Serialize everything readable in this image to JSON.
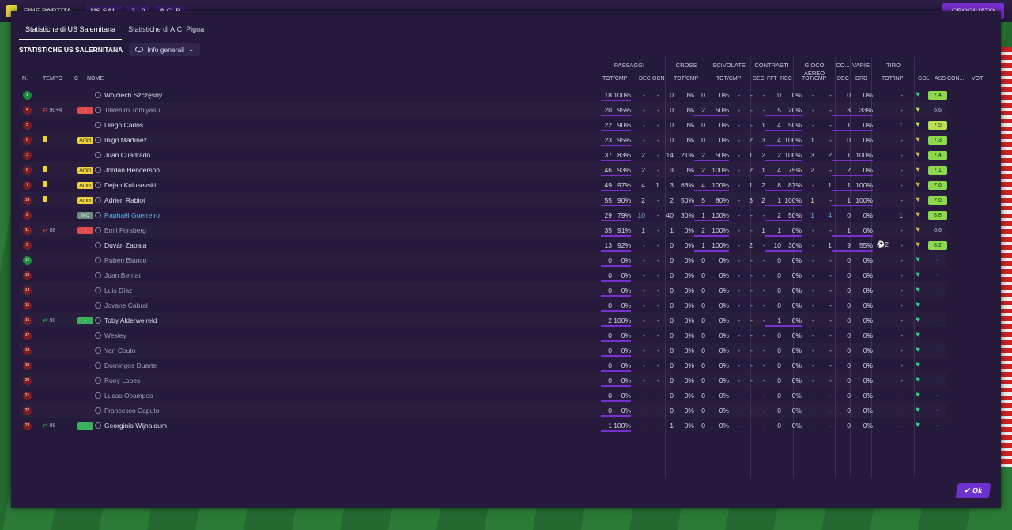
{
  "topbar": {
    "title": "FINE PARTITA",
    "home": "US SAL",
    "score": "2 - 0",
    "away": "A.C. P",
    "right_button": "CROGIUATO"
  },
  "tabs": [
    {
      "label": "Statistiche di US Salernitana",
      "active": true
    },
    {
      "label": "Statistiche di A.C. Pigna",
      "active": false
    }
  ],
  "subheader": {
    "title": "STATISTICHE US SALERNITANA",
    "dropdown": "Info generali"
  },
  "groups": [
    "PASSAGGI",
    "CROSS",
    "SCIVOLATE",
    "CONTRASTI",
    "GIOCO AEREO",
    "CO...",
    "VARIE",
    "TIRO"
  ],
  "columns": {
    "n": "N.",
    "tempo": "TEMPO",
    "c": "C",
    "nome": "NOME",
    "pass_tot": "TOT/CMP",
    "pass_dec": "DEC",
    "pass_ocn": "OCN",
    "cross_tot": "TOT/CMP",
    "sciv_tot": "TOT/CMP",
    "con_dec": "DEC",
    "con_fft": "FFT",
    "con_rec": "REC",
    "aer_tot": "TOT/CMP",
    "co_dec": "DEC",
    "var_drb": "DRB",
    "tiro_tot": "TOT/INP",
    "gol": "GOL",
    "ass": "ASS",
    "con": "CON...",
    "vot": "VOT"
  },
  "players": [
    {
      "num": "1",
      "badge": "g",
      "tempo": "",
      "card": "",
      "pos": "",
      "name": "Wojciech Szczęsny",
      "p": [
        "18",
        "100%",
        "-",
        "-"
      ],
      "cr": [
        "0",
        "0%"
      ],
      "sc": [
        "0",
        "0%"
      ],
      "ct": [
        "-",
        "-",
        "-"
      ],
      "ae": [
        "0",
        "0%"
      ],
      "cod": "-",
      "drb": "-",
      "ti": [
        "0",
        "0%"
      ],
      "gol": "",
      "ass": "-",
      "heart": "g",
      "vot": "7.4",
      "vc": "g"
    },
    {
      "num": "4",
      "badge": "r",
      "tempo": "90+4",
      "sub": "out",
      "card": "",
      "pos": "",
      "name": "Takehiro Tomiyasu",
      "dim": true,
      "p": [
        "20",
        "95%",
        "-",
        "-"
      ],
      "cr": [
        "0",
        "0%"
      ],
      "sc": [
        "2",
        "50%"
      ],
      "ct": [
        "-",
        "-",
        "-"
      ],
      "ae": [
        "5",
        "20%"
      ],
      "cod": "-",
      "drb": "-",
      "ti": [
        "3",
        "33%"
      ],
      "gol": "",
      "ass": "-",
      "heart": "y",
      "vot": "6.6",
      "vc": "n"
    },
    {
      "num": "5",
      "badge": "r",
      "tempo": "",
      "card": "",
      "pos": "",
      "name": "Diego Carlos",
      "p": [
        "22",
        "90%",
        "-",
        "-"
      ],
      "cr": [
        "0",
        "0%"
      ],
      "sc": [
        "0",
        "0%"
      ],
      "ct": [
        "-",
        "-",
        "1"
      ],
      "ae": [
        "4",
        "50%"
      ],
      "cod": "-",
      "drb": "-",
      "ti": [
        "1",
        "0%"
      ],
      "gol": "",
      "ass": "1",
      "heart": "y",
      "vot": "7.5",
      "vc": "y"
    },
    {
      "num": "6",
      "badge": "r",
      "tempo": "",
      "card": "y",
      "pos": "Amm",
      "name": "Iñigo Martínez",
      "p": [
        "23",
        "95%",
        "-",
        "-"
      ],
      "cr": [
        "0",
        "0%"
      ],
      "sc": [
        "0",
        "0%"
      ],
      "ct": [
        "-",
        "2",
        "3"
      ],
      "ae": [
        "4",
        "100%"
      ],
      "cod": "1",
      "drb": "-",
      "ti": [
        "0",
        "0%"
      ],
      "gol": "",
      "ass": "-",
      "heart": "o",
      "vot": "7.3",
      "vc": "g"
    },
    {
      "num": "3",
      "badge": "r",
      "tempo": "",
      "card": "",
      "pos": "",
      "name": "Juan Cuadrado",
      "p": [
        "37",
        "83%",
        "2",
        "-"
      ],
      "cr": [
        "14",
        "21%"
      ],
      "sc": [
        "2",
        "50%"
      ],
      "ct": [
        "-",
        "1",
        "2"
      ],
      "ae": [
        "2",
        "100%"
      ],
      "cod": "3",
      "drb": "2",
      "ti": [
        "1",
        "100%"
      ],
      "gol": "",
      "ass": "-",
      "heart": "o",
      "vot": "7.4",
      "vc": "g"
    },
    {
      "num": "8",
      "badge": "r",
      "tempo": "",
      "card": "y",
      "pos": "Amm",
      "name": "Jordan Henderson",
      "p": [
        "46",
        "93%",
        "2",
        "-"
      ],
      "cr": [
        "3",
        "0%"
      ],
      "sc": [
        "2",
        "100%"
      ],
      "ct": [
        "-",
        "2",
        "1"
      ],
      "ae": [
        "4",
        "75%"
      ],
      "cod": "2",
      "drb": "-",
      "ti": [
        "2",
        "0%"
      ],
      "gol": "",
      "ass": "-",
      "heart": "o",
      "vot": "7.1",
      "vc": "g"
    },
    {
      "num": "7",
      "badge": "r",
      "tempo": "",
      "card": "y",
      "pos": "Amm",
      "name": "Dejan Kulusevski",
      "p": [
        "49",
        "97%",
        "4",
        "1"
      ],
      "cr": [
        "3",
        "66%"
      ],
      "sc": [
        "4",
        "100%"
      ],
      "ct": [
        "-",
        "1",
        "2"
      ],
      "ae": [
        "8",
        "87%"
      ],
      "cod": "-",
      "drb": "1",
      "ti": [
        "1",
        "100%"
      ],
      "gol": "",
      "ass": "-",
      "heart": "o",
      "vot": "7.6",
      "vc": "g"
    },
    {
      "num": "18",
      "badge": "r",
      "tempo": "",
      "card": "y",
      "pos": "Amm",
      "name": "Adrien Rabiot",
      "p": [
        "55",
        "90%",
        "2",
        "-"
      ],
      "cr": [
        "2",
        "50%"
      ],
      "sc": [
        "5",
        "80%"
      ],
      "ct": [
        "-",
        "3",
        "2"
      ],
      "ae": [
        "1",
        "100%"
      ],
      "cod": "1",
      "drb": "-",
      "ti": [
        "1",
        "100%"
      ],
      "gol": "",
      "ass": "-",
      "heart": "o",
      "vot": "7.0",
      "vc": "g"
    },
    {
      "num": "2",
      "badge": "r",
      "tempo": "",
      "card": "",
      "pos": "MC",
      "name": "Raphaël Guerreiro",
      "hl": true,
      "p": [
        "29",
        "79%",
        "10",
        "-"
      ],
      "cr": [
        "40",
        "30%"
      ],
      "sc": [
        "1",
        "100%"
      ],
      "ct": [
        "-",
        "-",
        "-"
      ],
      "ae": [
        "2",
        "50%"
      ],
      "cod": "1",
      "drb": "4",
      "ti": [
        "0",
        "0%"
      ],
      "gol": "",
      "ass": "1",
      "heart": "o",
      "vot": "8.8",
      "vc": "g"
    },
    {
      "num": "11",
      "badge": "r",
      "tempo": "88",
      "sub": "out",
      "card": "",
      "pos": "",
      "name": "Emil Forsberg",
      "dim": true,
      "p": [
        "35",
        "91%",
        "1",
        "-"
      ],
      "cr": [
        "1",
        "0%"
      ],
      "sc": [
        "2",
        "100%"
      ],
      "ct": [
        "-",
        "-",
        "1"
      ],
      "ae": [
        "1",
        "0%"
      ],
      "cod": "-",
      "drb": "-",
      "ti": [
        "1",
        "0%"
      ],
      "gol": "",
      "ass": "-",
      "heart": "o",
      "vot": "6.6",
      "vc": "n"
    },
    {
      "num": "9",
      "badge": "r",
      "tempo": "",
      "card": "",
      "pos": "",
      "name": "Duván Zapata",
      "p": [
        "13",
        "92%",
        "-",
        "-"
      ],
      "cr": [
        "0",
        "0%"
      ],
      "sc": [
        "1",
        "100%"
      ],
      "ct": [
        "-",
        "2",
        "-"
      ],
      "ae": [
        "10",
        "30%"
      ],
      "cod": "-",
      "drb": "1",
      "ti": [
        "9",
        "55%"
      ],
      "gol": "⚽2",
      "ass": "-",
      "heart": "o",
      "vot": "8.2",
      "vc": "g"
    },
    {
      "num": "12",
      "badge": "g",
      "tempo": "",
      "card": "",
      "pos": "",
      "name": "Rubén Blanco",
      "dim": true,
      "p": [
        "0",
        "0%",
        "-",
        "-"
      ],
      "cr": [
        "0",
        "0%"
      ],
      "sc": [
        "0",
        "0%"
      ],
      "ct": [
        "-",
        "-",
        "-"
      ],
      "ae": [
        "0",
        "0%"
      ],
      "cod": "-",
      "drb": "-",
      "ti": [
        "0",
        "0%"
      ],
      "gol": "",
      "ass": "-",
      "heart": "g",
      "vot": "-",
      "vc": "n"
    },
    {
      "num": "13",
      "badge": "r",
      "tempo": "",
      "card": "",
      "pos": "",
      "name": "Juan Bernat",
      "dim": true,
      "p": [
        "0",
        "0%",
        "-",
        "-"
      ],
      "cr": [
        "0",
        "0%"
      ],
      "sc": [
        "0",
        "0%"
      ],
      "ct": [
        "-",
        "-",
        "-"
      ],
      "ae": [
        "0",
        "0%"
      ],
      "cod": "-",
      "drb": "-",
      "ti": [
        "0",
        "0%"
      ],
      "gol": "",
      "ass": "-",
      "heart": "g",
      "vot": "-",
      "vc": "n"
    },
    {
      "num": "14",
      "badge": "r",
      "tempo": "",
      "card": "",
      "pos": "",
      "name": "Luis Díaz",
      "dim": true,
      "p": [
        "0",
        "0%",
        "-",
        "-"
      ],
      "cr": [
        "0",
        "0%"
      ],
      "sc": [
        "0",
        "0%"
      ],
      "ct": [
        "-",
        "-",
        "-"
      ],
      "ae": [
        "0",
        "0%"
      ],
      "cod": "-",
      "drb": "-",
      "ti": [
        "0",
        "0%"
      ],
      "gol": "",
      "ass": "-",
      "heart": "g",
      "vot": "-",
      "vc": "n"
    },
    {
      "num": "15",
      "badge": "r",
      "tempo": "",
      "card": "",
      "pos": "",
      "name": "Jovane Cabral",
      "dim": true,
      "p": [
        "0",
        "0%",
        "-",
        "-"
      ],
      "cr": [
        "0",
        "0%"
      ],
      "sc": [
        "0",
        "0%"
      ],
      "ct": [
        "-",
        "-",
        "-"
      ],
      "ae": [
        "0",
        "0%"
      ],
      "cod": "-",
      "drb": "-",
      "ti": [
        "0",
        "0%"
      ],
      "gol": "",
      "ass": "-",
      "heart": "g",
      "vot": "-",
      "vc": "n"
    },
    {
      "num": "16",
      "badge": "r",
      "tempo": "90",
      "sub": "in",
      "card": "",
      "pos": "",
      "name": "Toby Alderweireld",
      "p": [
        "2",
        "100%",
        "-",
        "-"
      ],
      "cr": [
        "0",
        "0%"
      ],
      "sc": [
        "0",
        "0%"
      ],
      "ct": [
        "-",
        "-",
        "-"
      ],
      "ae": [
        "1",
        "0%"
      ],
      "cod": "-",
      "drb": "-",
      "ti": [
        "0",
        "0%"
      ],
      "gol": "",
      "ass": "-",
      "heart": "g",
      "vot": "-",
      "vc": "n"
    },
    {
      "num": "17",
      "badge": "r",
      "tempo": "",
      "card": "",
      "pos": "",
      "name": "Wesley",
      "dim": true,
      "p": [
        "0",
        "0%",
        "-",
        "-"
      ],
      "cr": [
        "0",
        "0%"
      ],
      "sc": [
        "0",
        "0%"
      ],
      "ct": [
        "-",
        "-",
        "-"
      ],
      "ae": [
        "0",
        "0%"
      ],
      "cod": "-",
      "drb": "-",
      "ti": [
        "0",
        "0%"
      ],
      "gol": "",
      "ass": "-",
      "heart": "g",
      "vot": "-",
      "vc": "n"
    },
    {
      "num": "18",
      "badge": "r",
      "tempo": "",
      "card": "",
      "pos": "",
      "name": "Yan Couto",
      "dim": true,
      "p": [
        "0",
        "0%",
        "-",
        "-"
      ],
      "cr": [
        "0",
        "0%"
      ],
      "sc": [
        "0",
        "0%"
      ],
      "ct": [
        "-",
        "-",
        "-"
      ],
      "ae": [
        "0",
        "0%"
      ],
      "cod": "-",
      "drb": "-",
      "ti": [
        "0",
        "0%"
      ],
      "gol": "",
      "ass": "-",
      "heart": "g",
      "vot": "-",
      "vc": "n"
    },
    {
      "num": "19",
      "badge": "r",
      "tempo": "",
      "card": "",
      "pos": "",
      "name": "Domingos Duarte",
      "dim": true,
      "p": [
        "0",
        "0%",
        "-",
        "-"
      ],
      "cr": [
        "0",
        "0%"
      ],
      "sc": [
        "0",
        "0%"
      ],
      "ct": [
        "-",
        "-",
        "-"
      ],
      "ae": [
        "0",
        "0%"
      ],
      "cod": "-",
      "drb": "-",
      "ti": [
        "0",
        "0%"
      ],
      "gol": "",
      "ass": "-",
      "heart": "g",
      "vot": "-",
      "vc": "n"
    },
    {
      "num": "20",
      "badge": "r",
      "tempo": "",
      "card": "",
      "pos": "",
      "name": "Rony Lopes",
      "dim": true,
      "p": [
        "0",
        "0%",
        "-",
        "-"
      ],
      "cr": [
        "0",
        "0%"
      ],
      "sc": [
        "0",
        "0%"
      ],
      "ct": [
        "-",
        "-",
        "-"
      ],
      "ae": [
        "0",
        "0%"
      ],
      "cod": "-",
      "drb": "-",
      "ti": [
        "0",
        "0%"
      ],
      "gol": "",
      "ass": "-",
      "heart": "g",
      "vot": "-",
      "vc": "n"
    },
    {
      "num": "21",
      "badge": "r",
      "tempo": "",
      "card": "",
      "pos": "",
      "name": "Lucas Ocampos",
      "dim": true,
      "p": [
        "0",
        "0%",
        "-",
        "-"
      ],
      "cr": [
        "0",
        "0%"
      ],
      "sc": [
        "0",
        "0%"
      ],
      "ct": [
        "-",
        "-",
        "-"
      ],
      "ae": [
        "0",
        "0%"
      ],
      "cod": "-",
      "drb": "-",
      "ti": [
        "0",
        "0%"
      ],
      "gol": "",
      "ass": "-",
      "heart": "g",
      "vot": "-",
      "vc": "n"
    },
    {
      "num": "22",
      "badge": "r",
      "tempo": "",
      "card": "",
      "pos": "",
      "name": "Francesco Caputo",
      "dim": true,
      "p": [
        "0",
        "0%",
        "-",
        "-"
      ],
      "cr": [
        "0",
        "0%"
      ],
      "sc": [
        "0",
        "0%"
      ],
      "ct": [
        "-",
        "-",
        "-"
      ],
      "ae": [
        "0",
        "0%"
      ],
      "cod": "-",
      "drb": "-",
      "ti": [
        "0",
        "0%"
      ],
      "gol": "",
      "ass": "-",
      "heart": "g",
      "vot": "-",
      "vc": "n"
    },
    {
      "num": "23",
      "badge": "r",
      "tempo": "88",
      "sub": "in",
      "card": "",
      "pos": "",
      "name": "Georginio Wijnaldum",
      "p": [
        "1",
        "100%",
        "-",
        "-"
      ],
      "cr": [
        "1",
        "0%"
      ],
      "sc": [
        "0",
        "0%"
      ],
      "ct": [
        "-",
        "-",
        "-"
      ],
      "ae": [
        "0",
        "0%"
      ],
      "cod": "-",
      "drb": "-",
      "ti": [
        "0",
        "0%"
      ],
      "gol": "",
      "ass": "-",
      "heart": "g",
      "vot": "-",
      "vc": "n"
    }
  ],
  "ok_button": "Ok",
  "colors": {
    "accent": "#7a2fd1",
    "panel": "#251a3b",
    "green": "#2ad67d",
    "yellow_card": "#f2d32a"
  }
}
